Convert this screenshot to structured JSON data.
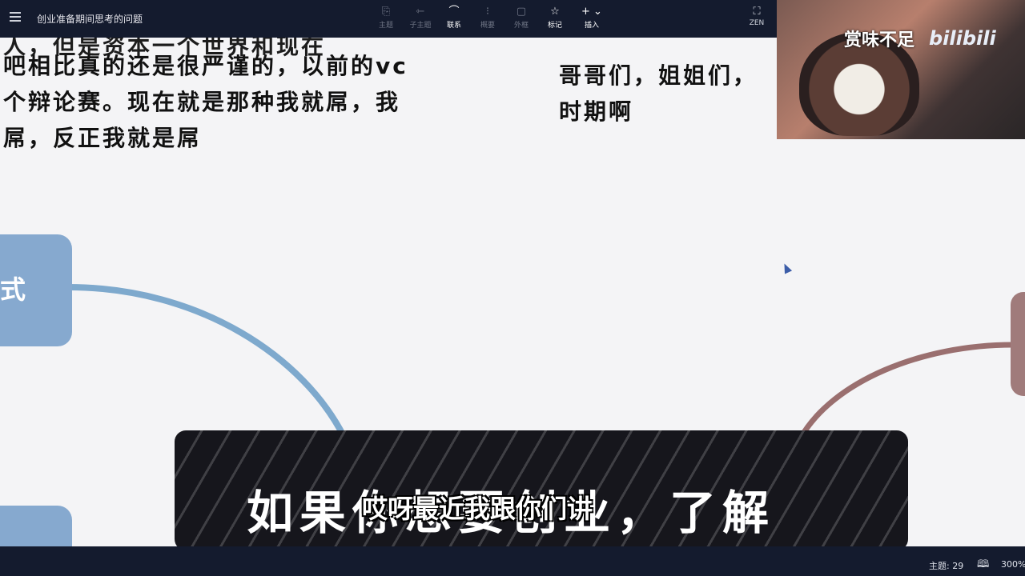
{
  "header": {
    "doc_title": "创业准备期间思考的问题",
    "tools": [
      {
        "label": "主题",
        "icon": "topic-icon",
        "active": false
      },
      {
        "label": "子主题",
        "icon": "subtopic-icon",
        "active": false
      },
      {
        "label": "联系",
        "icon": "relationship-icon",
        "active": true
      },
      {
        "label": "概要",
        "icon": "summary-icon",
        "active": false
      },
      {
        "label": "外框",
        "icon": "boundary-icon",
        "active": false
      },
      {
        "label": "标记",
        "icon": "marker-icon",
        "active": true
      },
      {
        "label": "插入",
        "icon": "insert-icon",
        "active": true
      }
    ],
    "zen_label": "ZEN"
  },
  "canvas": {
    "left_text_lines": [
      "吧相比真的还是很严谨的，以前的vc",
      "个辩论赛。现在就是那种我就屌，我",
      "屌，反正我就是屌"
    ],
    "left_text_partial": "人，但是资本一个世界和现在",
    "right_text_lines": [
      "哥哥们，姐姐们，",
      "时期啊"
    ],
    "node_left_top": "式",
    "colors": {
      "left_branch": "#7ea9cd",
      "right_branch": "#9a6f6f",
      "node": "#86a9cf"
    }
  },
  "webcam": {
    "caption": "赏味不足",
    "brand": "bilibili"
  },
  "banner": {
    "big_text": "如果你想要创业，了解",
    "subtitle": "哎呀最近我跟你们讲"
  },
  "status": {
    "topic_count": "主题: 29",
    "zoom": "300%"
  }
}
